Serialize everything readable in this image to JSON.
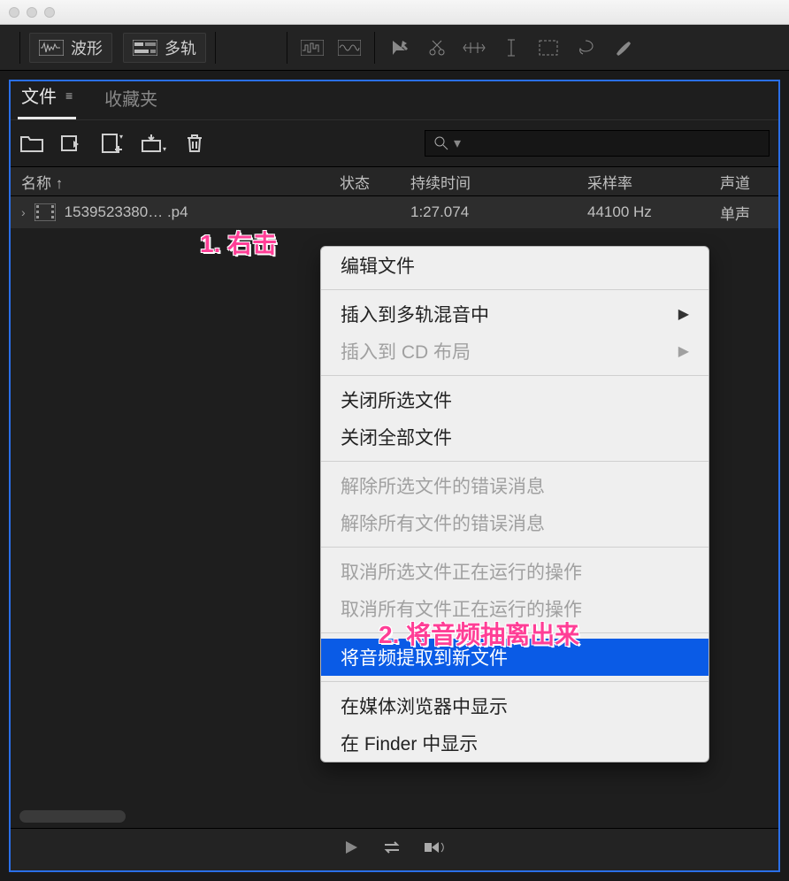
{
  "toolbar": {
    "waveform": "波形",
    "multitrack": "多轨"
  },
  "tabs": {
    "files": "文件",
    "favorites": "收藏夹"
  },
  "search": {
    "placeholder": ""
  },
  "columns": {
    "name": "名称 ↑",
    "status": "状态",
    "duration": "持续时间",
    "sampleRate": "采样率",
    "channels": "声道"
  },
  "rows": [
    {
      "name": "1539523380…  .p4",
      "status": "",
      "duration": "1:27.074",
      "sampleRate": "44100 Hz",
      "channels": "单声"
    }
  ],
  "contextMenu": {
    "items": [
      {
        "label": "编辑文件",
        "enabled": true
      },
      {
        "sep": true
      },
      {
        "label": "插入到多轨混音中",
        "enabled": true,
        "submenu": true
      },
      {
        "label": "插入到 CD 布局",
        "enabled": false,
        "submenu": true
      },
      {
        "sep": true
      },
      {
        "label": "关闭所选文件",
        "enabled": true
      },
      {
        "label": "关闭全部文件",
        "enabled": true
      },
      {
        "sep": true
      },
      {
        "label": "解除所选文件的错误消息",
        "enabled": false
      },
      {
        "label": "解除所有文件的错误消息",
        "enabled": false
      },
      {
        "sep": true
      },
      {
        "label": "取消所选文件正在运行的操作",
        "enabled": false
      },
      {
        "label": "取消所有文件正在运行的操作",
        "enabled": false
      },
      {
        "sep": true
      },
      {
        "label": "将音频提取到新文件",
        "enabled": true,
        "highlight": true
      },
      {
        "sep": true
      },
      {
        "label": "在媒体浏览器中显示",
        "enabled": true
      },
      {
        "label": "在 Finder 中显示",
        "enabled": true
      }
    ]
  },
  "annotations": {
    "step1": "1. 右击",
    "step2": "2. 将音频抽离出来"
  }
}
